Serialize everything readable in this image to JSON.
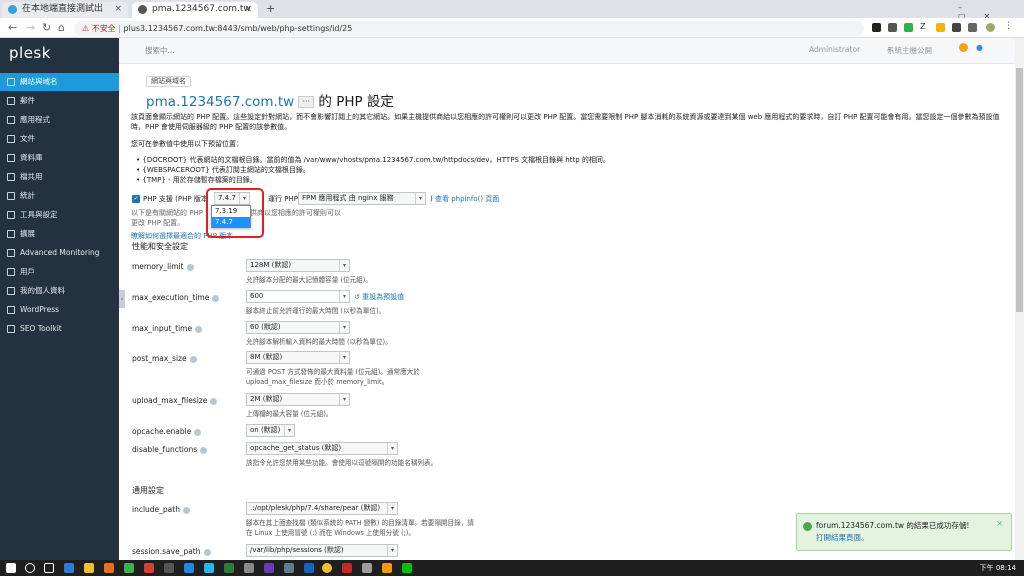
{
  "browser": {
    "tabs": [
      {
        "title": "在本地端直接測試出"
      },
      {
        "title": "pma.1234567.com.tw"
      }
    ],
    "new_tab": "+",
    "url_warning": "不安全",
    "url": "plus3.1234567.com.tw:8443/smb/web/php-settings/id/25"
  },
  "app": {
    "logo": "plesk",
    "search_placeholder": "搜索中...",
    "user_menu": "Administrator",
    "account_menu": "系統主機公開"
  },
  "sidebar": {
    "items": [
      {
        "label": "網站與域名"
      },
      {
        "label": "郵件"
      },
      {
        "label": "應用程式"
      },
      {
        "label": "文件"
      },
      {
        "label": "資料庫"
      },
      {
        "label": "檔共用"
      },
      {
        "label": "統計"
      },
      {
        "label": "工具與設定"
      },
      {
        "label": "擴展"
      },
      {
        "label": "Advanced Monitoring"
      },
      {
        "label": "用戶"
      },
      {
        "label": "我的個人資料"
      },
      {
        "label": "WordPress"
      },
      {
        "label": "SEO Toolkit"
      }
    ]
  },
  "page": {
    "breadcrumb": "網站與域名",
    "title_domain": "pma.1234567.com.tw",
    "title_dots": "···",
    "title_suffix": "的 PHP 設定",
    "intro": "該頁面會顯示網站的 PHP 配置。這些設定針對網站，而不會影響訂閱上的其它網站。如果主機提供商給以您相應的許可權則可以更改 PHP 配置。當您需要限制 PHP 腳本消耗的系統資源或要達到某個 web 應用程式的要求時，自訂 PHP 配置可能會有用。當您設定一個參數為預設值時，PHP 會使用伺服器級的 PHP 配置的該參數值。",
    "placeholders_intro": "您可在參數值中使用以下預留位置：",
    "placeholders": [
      "{DOCROOT} 代表網站的文檔根目錄。當前的值為 /var/www/vhosts/pma.1234567.com.tw/httpdocs/dev。HTTPS 文檔根目錄與 http 的相同。",
      "{WEBSPACEROOT} 代表訂閱主網站的文檔根目錄。",
      "{TMP} - 用於存儲暫存檔案的目錄。"
    ],
    "php_support_label": "PHP 支援 (PHP 版本",
    "php_version": "7.4.7",
    "php_version_options": [
      "7.3.19",
      "7.4.7"
    ],
    "run_as_label": "運行 PHP 以",
    "handler": "FPM 應用程式 由 nginx 服務",
    "phpinfo_link": "查看 phpinfo() 頁面",
    "php_note_prefix": "以下是有關網站的 PHP",
    "php_note_suffix": "如果主機提供商以您相應的許可權則可以",
    "php_note_line2": "更改 PHP 配置。",
    "learn_link": "瞭解如何選擇最適合的 PHP 版本",
    "section_perf": "性能和安全設定",
    "section_common": "通用設定",
    "reset_link": "重設為預設值"
  },
  "settings": [
    {
      "name": "memory_limit",
      "value": "128M (默認)",
      "hint": "允許腳本分配的最大記憶體容量 (位元組)。"
    },
    {
      "name": "max_execution_time",
      "value": "600",
      "hint": "腳本終止前允許運行的最大時間 (以秒為單位)。"
    },
    {
      "name": "max_input_time",
      "value": "60 (默認)",
      "hint": "允許腳本解析輸入資料的最大時間 (以秒為單位)。"
    },
    {
      "name": "post_max_size",
      "value": "8M (默認)",
      "hint": "可通過 POST 方式發佈的最大資料量 (位元組)。通常應大於",
      "hint2": "upload_max_filesize 而小於 memory_limit。"
    },
    {
      "name": "upload_max_filesize",
      "value": "2M (默認)",
      "hint": "上傳檔的最大容量 (位元組)。"
    },
    {
      "name": "opcache.enable",
      "value": "on (默認)",
      "hint": ""
    },
    {
      "name": "disable_functions",
      "value": "opcache_get_status (默認)",
      "hint": "該指令允許您禁用某些功能。會使用以逗號隔開的功能名稱列表。"
    },
    {
      "name": "include_path",
      "value": ".:/opt/plesk/php/7.4/share/pear (默認)",
      "hint": "腳本在其上面查找檔 (類似系統的 PATH 變數) 的目錄清單。若要隔開目錄，請",
      "hint2": "在 Linux 上使用冒號 (:) 而在 Windows 上使用分號 (;)。"
    },
    {
      "name": "session.save_path",
      "value": "/var/lib/php/sessions (默認)",
      "hint": ""
    }
  ],
  "toast": {
    "message": "forum.1234567.com.tw 的結果已成功存儲!",
    "link": "打開結果頁面。",
    "close": "×"
  },
  "taskbar": {
    "time": "下午 08:14"
  },
  "colors": {
    "sidebar_bg": "#233240",
    "active_nav": "#1d9bd8",
    "link": "#1d74b0",
    "highlight_box": "#e02020",
    "toast_bg": "#e3f3e0"
  }
}
